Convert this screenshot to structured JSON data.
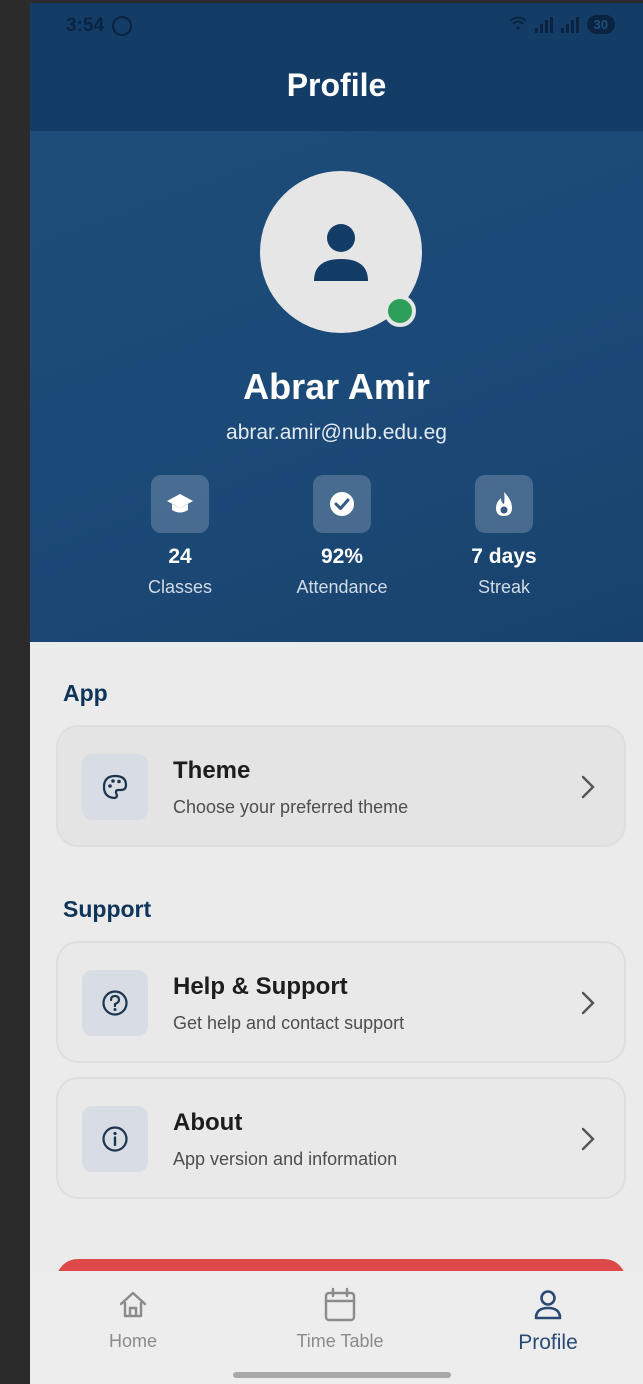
{
  "status_bar": {
    "time": "3:54",
    "battery": "30"
  },
  "app_bar": {
    "title": "Profile"
  },
  "profile": {
    "name": "Abrar Amir",
    "email": "abrar.amir@nub.edu.eg",
    "online": true
  },
  "stats": [
    {
      "icon": "graduation-cap-icon",
      "value": "24",
      "label": "Classes"
    },
    {
      "icon": "check-circle-icon",
      "value": "92%",
      "label": "Attendance"
    },
    {
      "icon": "fire-icon",
      "value": "7 days",
      "label": "Streak"
    }
  ],
  "sections": {
    "app": {
      "title": "App",
      "items": [
        {
          "icon": "palette-icon",
          "title": "Theme",
          "subtitle": "Choose your preferred theme"
        }
      ]
    },
    "support": {
      "title": "Support",
      "items": [
        {
          "icon": "help-circle-icon",
          "title": "Help & Support",
          "subtitle": "Get help and contact support"
        },
        {
          "icon": "info-circle-icon",
          "title": "About",
          "subtitle": "App version and information"
        }
      ]
    }
  },
  "bottom_nav": {
    "items": [
      {
        "icon": "home-icon",
        "label": "Home",
        "active": false
      },
      {
        "icon": "calendar-icon",
        "label": "Time Table",
        "active": false
      },
      {
        "icon": "profile-icon",
        "label": "Profile",
        "active": true
      }
    ]
  },
  "colors": {
    "primary": "#133d67",
    "header": "#1c4a78",
    "online": "#2e9e5b",
    "logout": "#dd4848",
    "active_nav": "#2a4a75"
  }
}
